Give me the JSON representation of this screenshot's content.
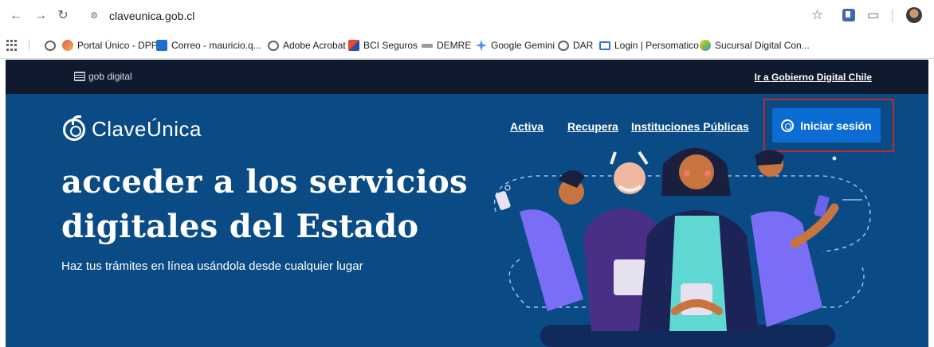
{
  "browser": {
    "url": "claveunica.gob.cl",
    "bookmarks": [
      {
        "label": "Portal Único - DPP",
        "icon": "portal-icon",
        "color": "#d9534f"
      },
      {
        "label": "Correo - mauricio.q...",
        "icon": "outlook-icon",
        "color": "#1e6fcc"
      },
      {
        "label": "Adobe Acrobat",
        "icon": "globe-icon",
        "color": "#5f6368"
      },
      {
        "label": "BCI Seguros",
        "icon": "bci-icon",
        "color": "#e8482f"
      },
      {
        "label": "DEMRE",
        "icon": "demre-icon",
        "color": "#8a8a8a"
      },
      {
        "label": "Google Gemini",
        "icon": "gemini-icon",
        "color": "#4b8cf5"
      },
      {
        "label": "DAR",
        "icon": "globe-icon",
        "color": "#5f6368"
      },
      {
        "label": "Login | Persomatico",
        "icon": "persomatico-icon",
        "color": "#2f6fde"
      },
      {
        "label": "Sucursal Digital Con...",
        "icon": "sucursal-icon",
        "color": "#7bc043"
      }
    ]
  },
  "site": {
    "gob_logo": "gob digital",
    "gob_link": "Ir a Gobierno Digital Chile",
    "brand": "ClaveÚnica",
    "nav": {
      "activa": "Activa",
      "recupera": "Recupera",
      "instituciones": "Instituciones Públicas",
      "login": "Iniciar sesión"
    },
    "headline_line1": "acceder a los servicios",
    "headline_line2": "digitales del Estado",
    "subline": "Haz tus trámites en línea usándola desde cualquier lugar",
    "colors": {
      "top_bar": "#0f1a2e",
      "hero_bg": "#0a4b86",
      "login_button": "#0b6cd3",
      "highlight_outline": "#c0272d"
    }
  }
}
